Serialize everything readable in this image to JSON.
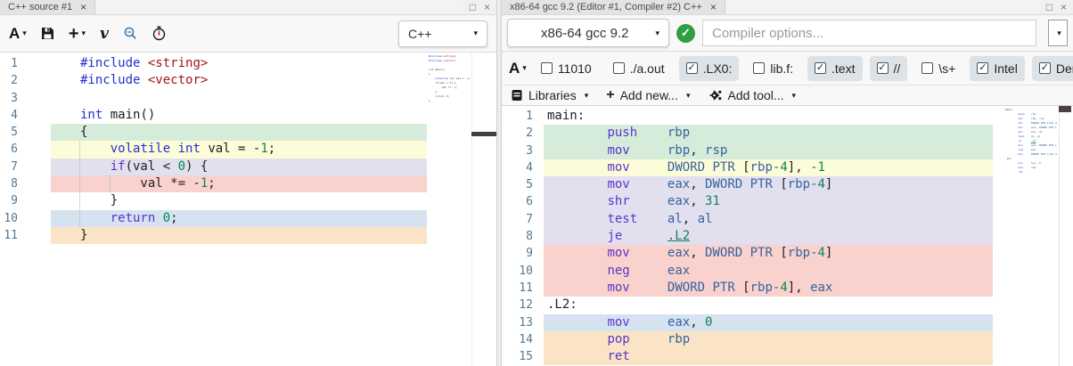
{
  "ui": {
    "caret": "▾",
    "close_glyph": "×",
    "maximize_glyph": "□",
    "check_glyph": "✓"
  },
  "highlight_colors": {
    "none": "transparent",
    "green": "#d5ecdb",
    "yellow": "#fcfcd8",
    "purple": "#e2e0ef",
    "red": "#f9d2ce",
    "blue": "#d5e3f0",
    "orange": "#fbe4c5"
  },
  "source_pane": {
    "tab_title": "C++ source #1",
    "toolbar": {
      "font_button": "A",
      "add_button": "+",
      "vim_button": "v",
      "language_selector": "C++"
    },
    "editor": {
      "lines": [
        {
          "hl": "none",
          "seg": [
            [
              "kw",
              "#include"
            ],
            [
              "p",
              " "
            ],
            [
              "str",
              "<string>"
            ]
          ]
        },
        {
          "hl": "none",
          "seg": [
            [
              "kw",
              "#include"
            ],
            [
              "p",
              " "
            ],
            [
              "str",
              "<vector>"
            ]
          ]
        },
        {
          "hl": "none",
          "seg": []
        },
        {
          "hl": "none",
          "seg": [
            [
              "kw",
              "int"
            ],
            [
              "p",
              " main()"
            ]
          ]
        },
        {
          "hl": "green",
          "seg": [
            [
              "p",
              "{"
            ]
          ]
        },
        {
          "hl": "yellow",
          "seg": [
            [
              "p",
              "    "
            ],
            [
              "kw",
              "volatile"
            ],
            [
              "p",
              " "
            ],
            [
              "kw",
              "int"
            ],
            [
              "p",
              " val = -"
            ],
            [
              "num",
              "1"
            ],
            [
              "p",
              ";"
            ]
          ]
        },
        {
          "hl": "purple",
          "seg": [
            [
              "p",
              "    "
            ],
            [
              "ctl",
              "if"
            ],
            [
              "p",
              "(val < "
            ],
            [
              "num",
              "0"
            ],
            [
              "p",
              ") {"
            ]
          ]
        },
        {
          "hl": "red",
          "seg": [
            [
              "p",
              "        val *= -"
            ],
            [
              "num",
              "1"
            ],
            [
              "p",
              ";"
            ]
          ]
        },
        {
          "hl": "none",
          "seg": [
            [
              "p",
              "    }"
            ]
          ]
        },
        {
          "hl": "blue",
          "seg": [
            [
              "p",
              "    "
            ],
            [
              "ctl",
              "return"
            ],
            [
              "p",
              " "
            ],
            [
              "num",
              "0"
            ],
            [
              "p",
              ";"
            ]
          ]
        },
        {
          "hl": "orange",
          "seg": [
            [
              "p",
              "}"
            ]
          ]
        }
      ]
    }
  },
  "asm_pane": {
    "tab_title": "x86-64 gcc 9.2 (Editor #1, Compiler #2) C++",
    "compiler_selector": "x86-64 gcc 9.2",
    "options_placeholder": "Compiler options...",
    "filters": [
      {
        "label": "11010",
        "checked": false
      },
      {
        "label": "./a.out",
        "checked": false
      },
      {
        "label": ".LX0:",
        "checked": true
      },
      {
        "label": "lib.f:",
        "checked": false
      },
      {
        "label": ".text",
        "checked": true
      },
      {
        "label": "//",
        "checked": true
      },
      {
        "label": "\\s+",
        "checked": false
      },
      {
        "label": "Intel",
        "checked": true
      },
      {
        "label": "Demangle",
        "checked": true
      }
    ],
    "actions": [
      {
        "label": "Libraries"
      },
      {
        "label": "Add new..."
      },
      {
        "label": "Add tool..."
      }
    ],
    "editor": {
      "lines": [
        {
          "hl": "none",
          "seg": [
            [
              "lbl",
              "main:"
            ]
          ]
        },
        {
          "hl": "green",
          "seg": [
            [
              "p",
              "        "
            ],
            [
              "mn",
              "push"
            ],
            [
              "p",
              "    "
            ],
            [
              "reg",
              "rbp"
            ]
          ]
        },
        {
          "hl": "green",
          "seg": [
            [
              "p",
              "        "
            ],
            [
              "mn",
              "mov"
            ],
            [
              "p",
              "     "
            ],
            [
              "reg",
              "rbp"
            ],
            [
              "p",
              ", "
            ],
            [
              "reg",
              "rsp"
            ]
          ]
        },
        {
          "hl": "yellow",
          "seg": [
            [
              "p",
              "        "
            ],
            [
              "mn",
              "mov"
            ],
            [
              "p",
              "     "
            ],
            [
              "reg",
              "DWORD PTR"
            ],
            [
              "p",
              " ["
            ],
            [
              "reg",
              "rbp"
            ],
            [
              "num",
              "-4"
            ],
            [
              "p",
              "], "
            ],
            [
              "num",
              "-1"
            ]
          ]
        },
        {
          "hl": "purple",
          "seg": [
            [
              "p",
              "        "
            ],
            [
              "mn",
              "mov"
            ],
            [
              "p",
              "     "
            ],
            [
              "reg",
              "eax"
            ],
            [
              "p",
              ", "
            ],
            [
              "reg",
              "DWORD PTR"
            ],
            [
              "p",
              " ["
            ],
            [
              "reg",
              "rbp"
            ],
            [
              "num",
              "-4"
            ],
            [
              "p",
              "]"
            ]
          ]
        },
        {
          "hl": "purple",
          "seg": [
            [
              "p",
              "        "
            ],
            [
              "mn",
              "shr"
            ],
            [
              "p",
              "     "
            ],
            [
              "reg",
              "eax"
            ],
            [
              "p",
              ", "
            ],
            [
              "num",
              "31"
            ]
          ]
        },
        {
          "hl": "purple",
          "seg": [
            [
              "p",
              "        "
            ],
            [
              "mn",
              "test"
            ],
            [
              "p",
              "    "
            ],
            [
              "reg",
              "al"
            ],
            [
              "p",
              ", "
            ],
            [
              "reg",
              "al"
            ]
          ]
        },
        {
          "hl": "purple",
          "seg": [
            [
              "p",
              "        "
            ],
            [
              "mn",
              "je"
            ],
            [
              "p",
              "      "
            ],
            [
              "lnk",
              ".L2"
            ]
          ]
        },
        {
          "hl": "red",
          "seg": [
            [
              "p",
              "        "
            ],
            [
              "mn",
              "mov"
            ],
            [
              "p",
              "     "
            ],
            [
              "reg",
              "eax"
            ],
            [
              "p",
              ", "
            ],
            [
              "reg",
              "DWORD PTR"
            ],
            [
              "p",
              " ["
            ],
            [
              "reg",
              "rbp"
            ],
            [
              "num",
              "-4"
            ],
            [
              "p",
              "]"
            ]
          ]
        },
        {
          "hl": "red",
          "seg": [
            [
              "p",
              "        "
            ],
            [
              "mn",
              "neg"
            ],
            [
              "p",
              "     "
            ],
            [
              "reg",
              "eax"
            ]
          ]
        },
        {
          "hl": "red",
          "seg": [
            [
              "p",
              "        "
            ],
            [
              "mn",
              "mov"
            ],
            [
              "p",
              "     "
            ],
            [
              "reg",
              "DWORD PTR"
            ],
            [
              "p",
              " ["
            ],
            [
              "reg",
              "rbp"
            ],
            [
              "num",
              "-4"
            ],
            [
              "p",
              "], "
            ],
            [
              "reg",
              "eax"
            ]
          ]
        },
        {
          "hl": "none",
          "seg": [
            [
              "lbl",
              ".L2:"
            ]
          ]
        },
        {
          "hl": "blue",
          "seg": [
            [
              "p",
              "        "
            ],
            [
              "mn",
              "mov"
            ],
            [
              "p",
              "     "
            ],
            [
              "reg",
              "eax"
            ],
            [
              "p",
              ", "
            ],
            [
              "num",
              "0"
            ]
          ]
        },
        {
          "hl": "orange",
          "seg": [
            [
              "p",
              "        "
            ],
            [
              "mn",
              "pop"
            ],
            [
              "p",
              "     "
            ],
            [
              "reg",
              "rbp"
            ]
          ]
        },
        {
          "hl": "orange",
          "seg": [
            [
              "p",
              "        "
            ],
            [
              "mn",
              "ret"
            ]
          ]
        }
      ]
    }
  }
}
